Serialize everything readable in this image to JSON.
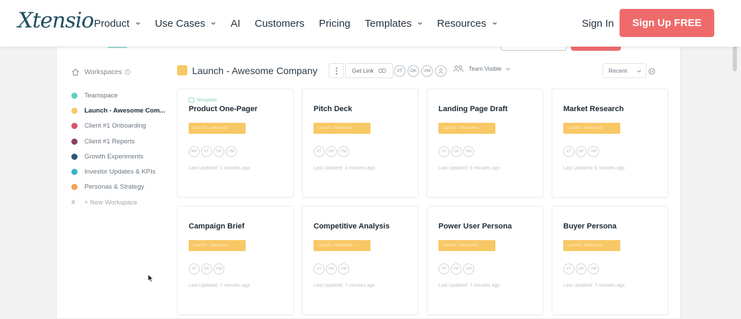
{
  "brand": {
    "logo_text": "Xtensio",
    "accent": "#ef6b6b",
    "logo_color": "#1f4e5f"
  },
  "nav": {
    "items": [
      {
        "label": "Product",
        "has_dropdown": true
      },
      {
        "label": "Use Cases",
        "has_dropdown": true
      },
      {
        "label": "AI",
        "has_dropdown": false
      },
      {
        "label": "Customers",
        "has_dropdown": false
      },
      {
        "label": "Pricing",
        "has_dropdown": false
      },
      {
        "label": "Templates",
        "has_dropdown": true
      },
      {
        "label": "Resources",
        "has_dropdown": true
      }
    ],
    "sign_in": "Sign In",
    "signup": "Sign Up FREE"
  },
  "sidebar": {
    "heading": "Workspaces",
    "info_icon": "info-icon",
    "items": [
      {
        "label": "Teamspace",
        "color": "#5fcfc5",
        "active": false
      },
      {
        "label": "Launch - Awesome Com...",
        "color": "#f7c964",
        "active": true
      },
      {
        "label": "Client #1 Onboarding",
        "color": "#d9536a",
        "active": false
      },
      {
        "label": "Client #1 Reports",
        "color": "#8a3f63",
        "active": false
      },
      {
        "label": "Growth Experiments",
        "color": "#2f5574",
        "active": false
      },
      {
        "label": "Investor Updates & KPIs",
        "color": "#39b5c8",
        "active": false
      },
      {
        "label": "Personas & Strategy",
        "color": "#f0a25a",
        "active": false
      }
    ],
    "new_workspace": "+ New Workspace"
  },
  "toolbar": {
    "workspace_title": "Launch - Awesome Company",
    "workspace_color": "#f7c964",
    "get_link": "Get Link",
    "members": [
      "XT",
      "OK",
      "VM"
    ],
    "visibility": "Team Visible",
    "sort": "Recent"
  },
  "cards": [
    {
      "template_badge": "Template",
      "title": "Product One-Pager",
      "tag": "Launch - Awesome",
      "members": [
        "MK",
        "XT",
        "OK",
        "VM"
      ],
      "updated": "Last Updated: 1 minutes ago"
    },
    {
      "template_badge": "",
      "title": "Pitch Deck",
      "tag": "Launch - Awesome",
      "members": [
        "XT",
        "OK",
        "VM"
      ],
      "updated": "Last Updated: 4 minutes ago"
    },
    {
      "template_badge": "",
      "title": "Landing Page Draft",
      "tag": "Launch - Awesome",
      "members": [
        "XT",
        "OK",
        "VM"
      ],
      "updated": "Last Updated: 5 minutes ago"
    },
    {
      "template_badge": "",
      "title": "Market Research",
      "tag": "Launch - Awesome",
      "members": [
        "XT",
        "OK",
        "VM"
      ],
      "updated": "Last Updated: 6 minutes ago"
    },
    {
      "template_badge": "",
      "title": "Campaign Brief",
      "tag": "Launch - Awesome",
      "members": [
        "XT",
        "OK",
        "VM"
      ],
      "updated": "Last Updated: 7 minutes ago"
    },
    {
      "template_badge": "",
      "title": "Competitive Analysis",
      "tag": "Launch - Awesome",
      "members": [
        "XT",
        "OK",
        "VM"
      ],
      "updated": "Last Updated: 7 minutes ago"
    },
    {
      "template_badge": "",
      "title": "Power User Persona",
      "tag": "Launch - Awesome",
      "members": [
        "XT",
        "OK",
        "VM"
      ],
      "updated": "Last Updated: 7 minutes ago"
    },
    {
      "template_badge": "",
      "title": "Buyer Persona",
      "tag": "Launch - Awesome",
      "members": [
        "XT",
        "OK",
        "VM"
      ],
      "updated": "Last Updated: 7 minutes ago"
    }
  ]
}
